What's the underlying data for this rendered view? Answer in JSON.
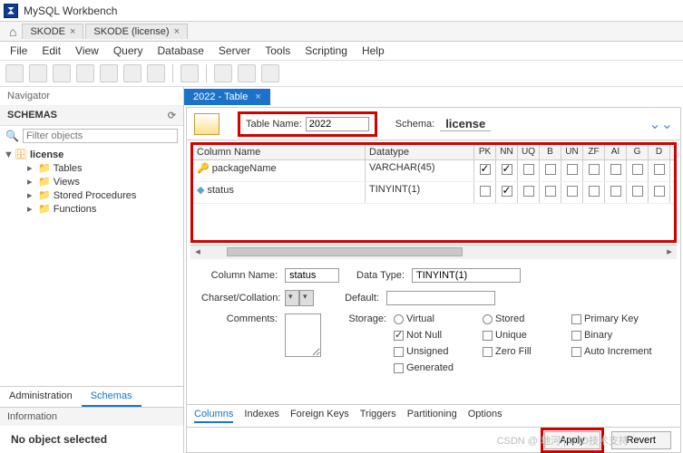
{
  "app_title": "MySQL Workbench",
  "window_tabs": [
    "SKODE",
    "SKODE (license)"
  ],
  "menu": [
    "File",
    "Edit",
    "View",
    "Query",
    "Database",
    "Server",
    "Tools",
    "Scripting",
    "Help"
  ],
  "navigator": {
    "title": "Navigator",
    "schemas_label": "SCHEMAS",
    "filter_placeholder": "Filter objects",
    "db_name": "license",
    "folders": [
      "Tables",
      "Views",
      "Stored Procedures",
      "Functions"
    ],
    "bottom_tabs": [
      "Administration",
      "Schemas"
    ],
    "info_label": "Information",
    "no_object": "No object selected"
  },
  "editor": {
    "tab_title": "2022 - Table",
    "table_name_label": "Table Name:",
    "table_name_value": "2022",
    "schema_label": "Schema:",
    "schema_value": "license",
    "grid_headers": {
      "name": "Column Name",
      "type": "Datatype",
      "flags": [
        "PK",
        "NN",
        "UQ",
        "B",
        "UN",
        "ZF",
        "AI",
        "G",
        "D"
      ]
    },
    "columns": [
      {
        "icon": "key",
        "name": "packageName",
        "datatype": "VARCHAR(45)",
        "pk": true,
        "nn": true
      },
      {
        "icon": "dia",
        "name": "status",
        "datatype": "TINYINT(1)",
        "pk": false,
        "nn": true
      }
    ],
    "detail": {
      "column_name_label": "Column Name:",
      "column_name_value": "status",
      "data_type_label": "Data Type:",
      "data_type_value": "TINYINT(1)",
      "charset_label": "Charset/Collation:",
      "default_label": "Default:",
      "comments_label": "Comments:",
      "storage_label": "Storage:",
      "virtual": "Virtual",
      "stored": "Stored",
      "primary_key": "Primary Key",
      "not_null": "Not Null",
      "unique": "Unique",
      "binary": "Binary",
      "unsigned": "Unsigned",
      "zero_fill": "Zero Fill",
      "auto_inc": "Auto Increment",
      "generated": "Generated",
      "not_null_checked": true
    },
    "sub_tabs": [
      "Columns",
      "Indexes",
      "Foreign Keys",
      "Triggers",
      "Partitioning",
      "Options"
    ],
    "apply": "Apply",
    "revert": "Revert"
  },
  "watermark": "CSDN @ 地河 | U3D技术支持"
}
